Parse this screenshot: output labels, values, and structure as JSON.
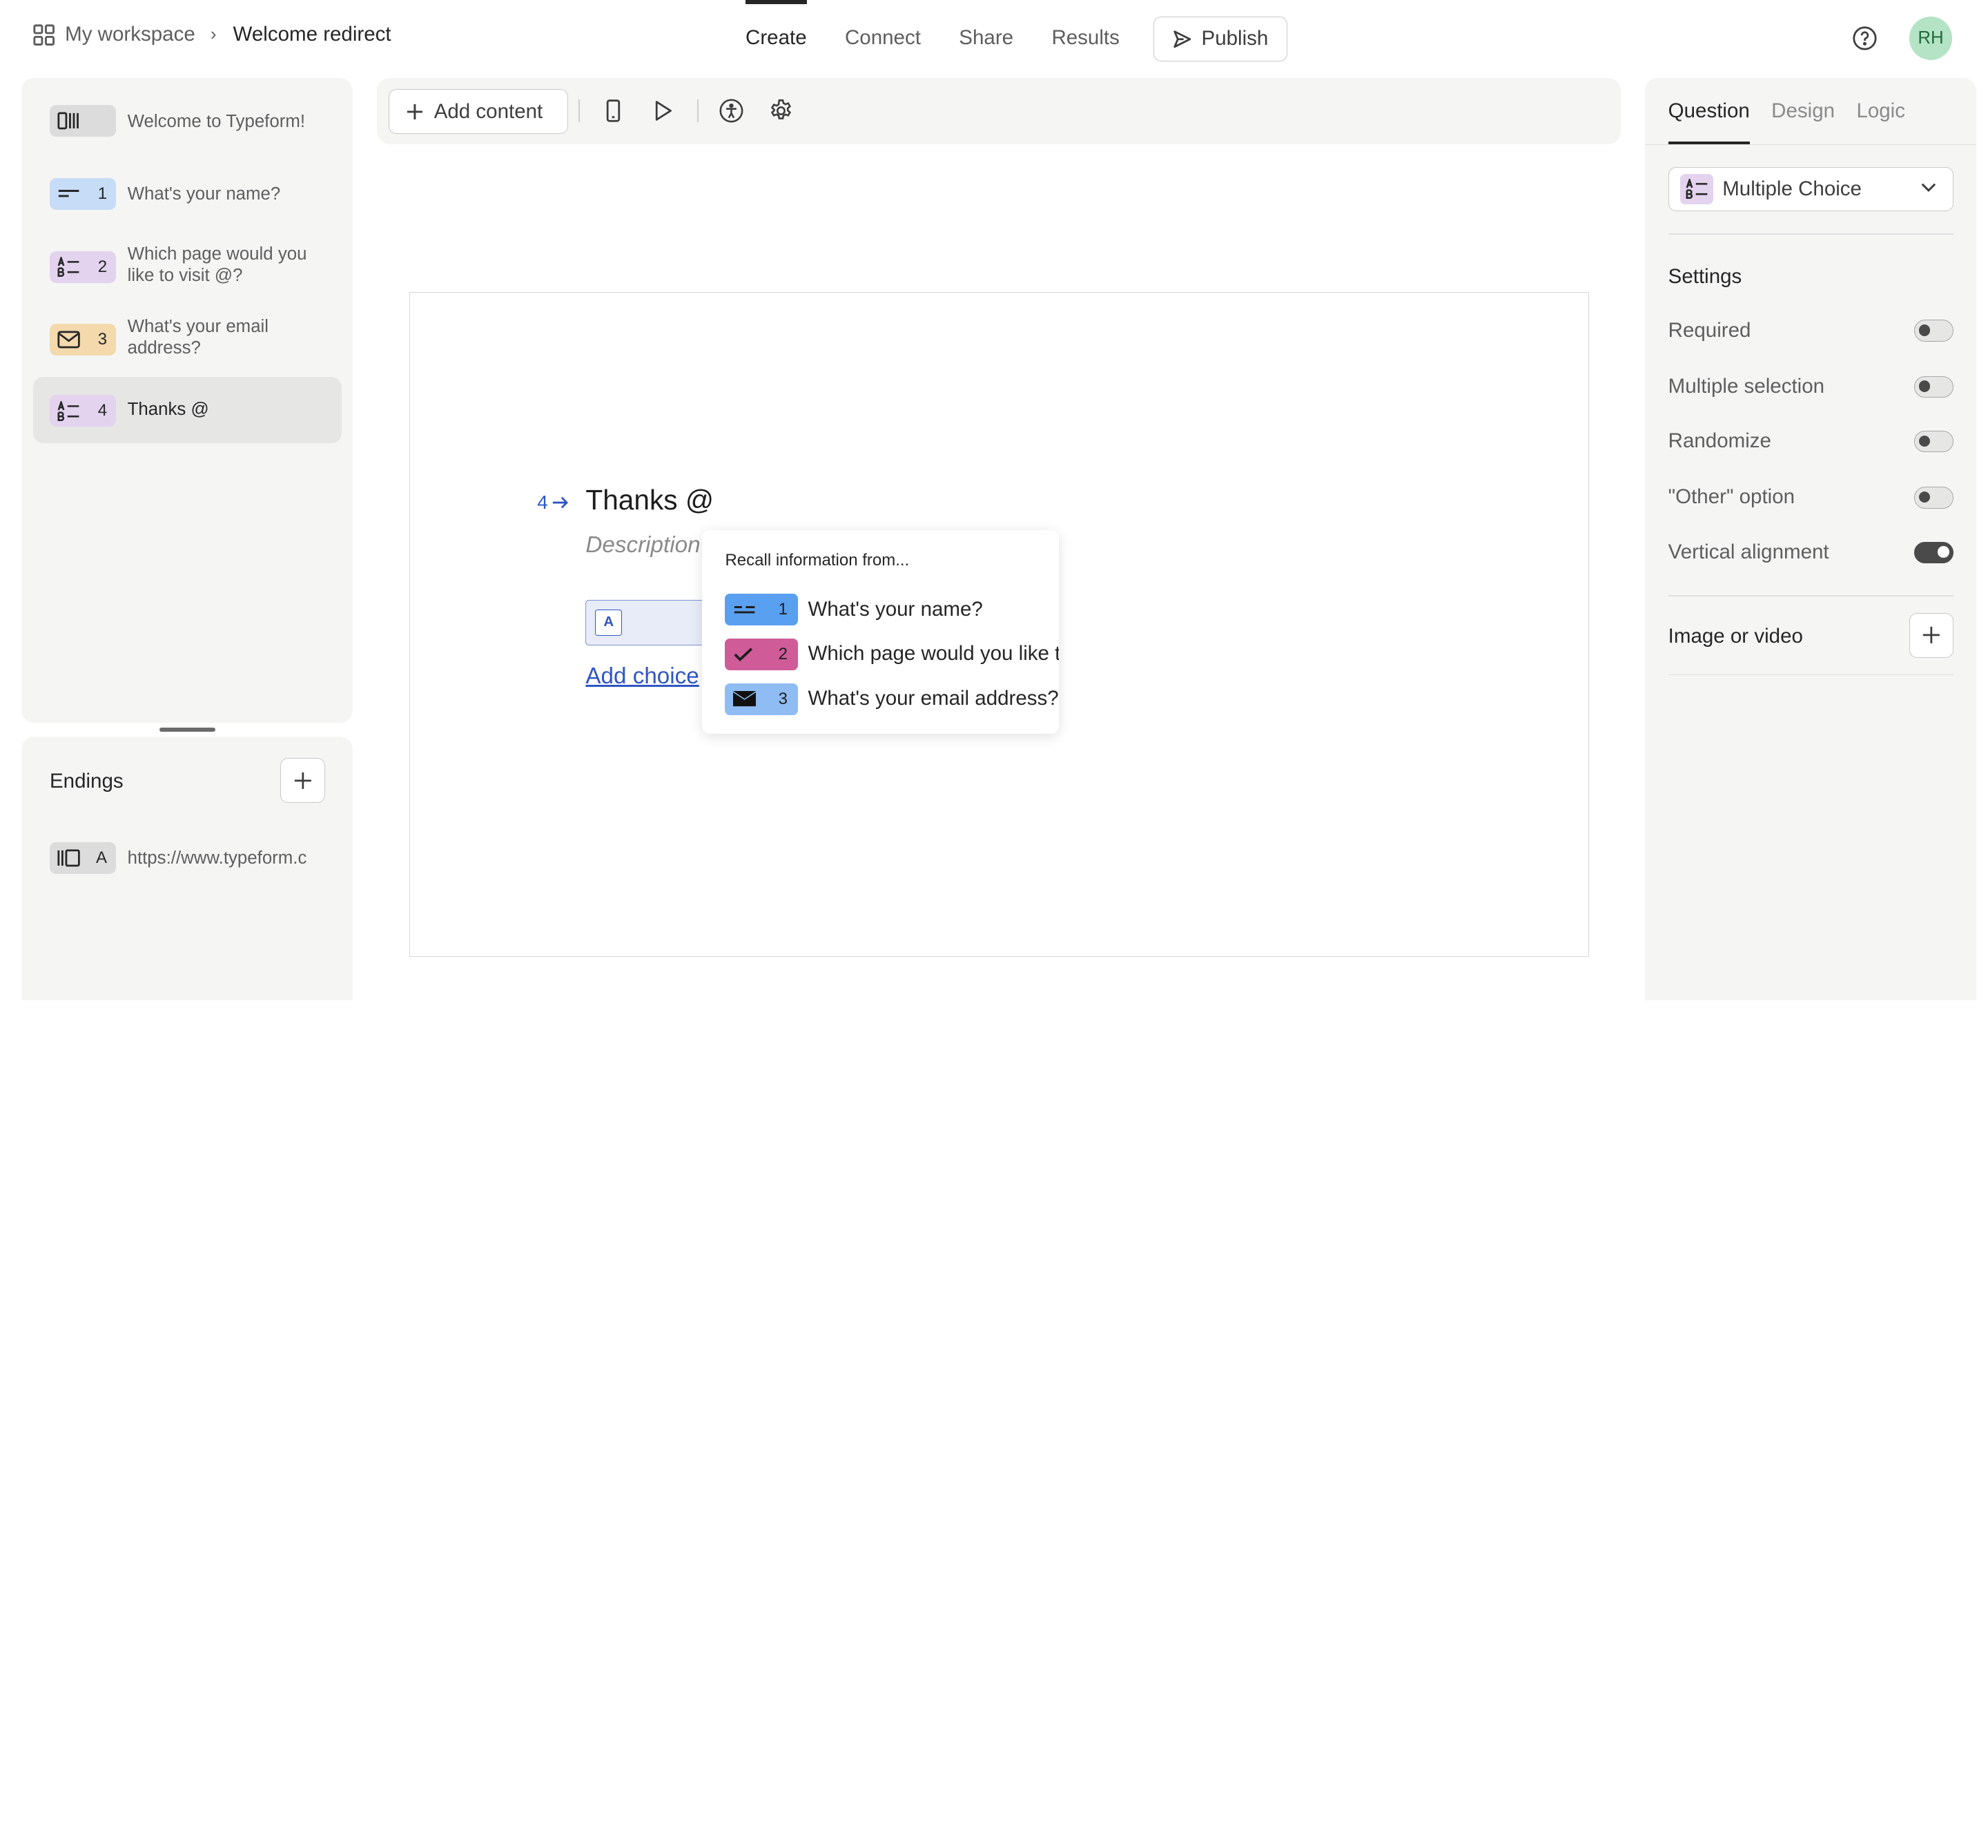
{
  "nav": {
    "workspace": "My workspace",
    "current": "Welcome redirect",
    "tabs": [
      "Create",
      "Connect",
      "Share",
      "Results"
    ],
    "active_tab": "Create",
    "publish": "Publish",
    "avatar": "RH"
  },
  "questions": [
    {
      "num": "",
      "label": "Welcome to Typeform!",
      "type": "welcome",
      "color": "#dcdcdc"
    },
    {
      "num": "1",
      "label": "What's your name?",
      "type": "short-text",
      "color": "#c7dcf6"
    },
    {
      "num": "2",
      "label": "Which page would you like to visit @?",
      "type": "multiple-choice",
      "color": "#e3d3ee"
    },
    {
      "num": "3",
      "label": "What's your email address?",
      "type": "email",
      "color": "#f3d9ac"
    },
    {
      "num": "4",
      "label": "Thanks @",
      "type": "multiple-choice",
      "color": "#e3d3ee"
    }
  ],
  "endings": {
    "title": "Endings",
    "items": [
      {
        "key": "A",
        "label": "https://www.typeform.c"
      }
    ]
  },
  "toolbar": {
    "add_content": "Add content"
  },
  "editor": {
    "number": "4",
    "title": "Thanks @",
    "description_placeholder": "Description",
    "choice_key": "A",
    "add_choice": "Add choice"
  },
  "recall": {
    "title": "Recall information from...",
    "items": [
      {
        "num": "1",
        "label": "What's your name?",
        "color": "#5aa0f0",
        "icon": "short-text-icon"
      },
      {
        "num": "2",
        "label": "Which page would you like t",
        "color": "#cf5c98",
        "icon": "check-icon"
      },
      {
        "num": "3",
        "label": "What's your email address?",
        "color": "#8fbcf2",
        "icon": "envelope-icon"
      }
    ]
  },
  "right": {
    "tabs": [
      "Question",
      "Design",
      "Logic"
    ],
    "active_tab": "Question",
    "question_type": "Multiple Choice",
    "settings_title": "Settings",
    "settings": [
      {
        "label": "Required",
        "on": false
      },
      {
        "label": "Multiple selection",
        "on": false
      },
      {
        "label": "Randomize",
        "on": false
      },
      {
        "label": "\"Other\" option",
        "on": false
      },
      {
        "label": "Vertical alignment",
        "on": true
      }
    ],
    "image_or_video": "Image or video"
  }
}
